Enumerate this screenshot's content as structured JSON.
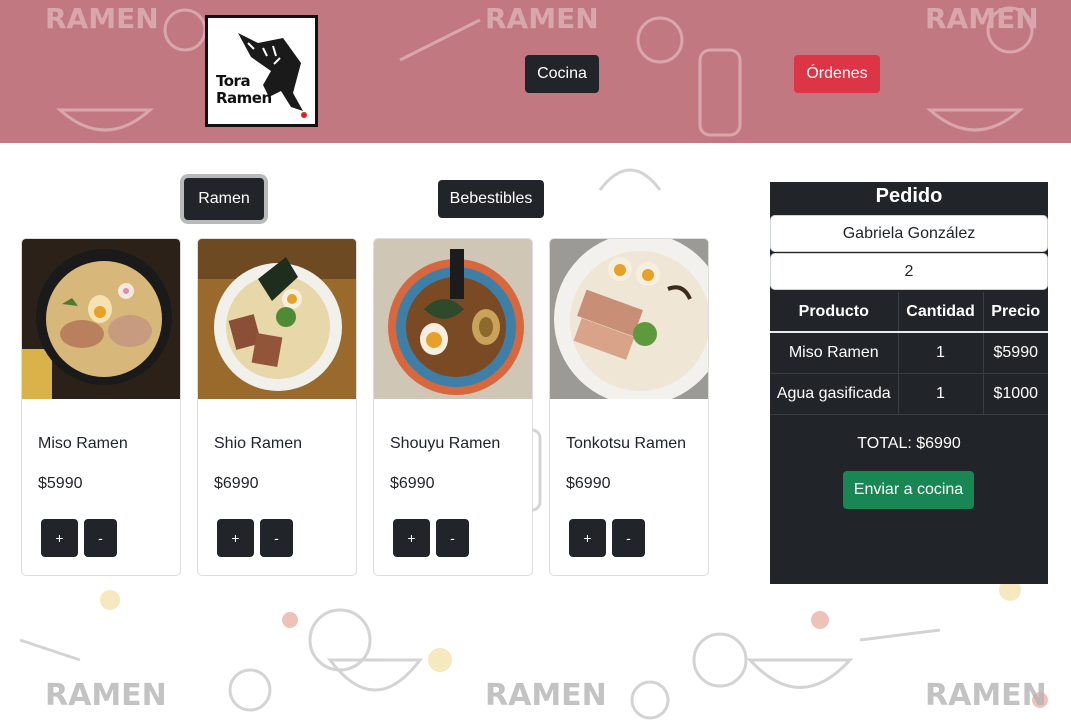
{
  "header": {
    "logo_line1": "Tora",
    "logo_line2": "Ramen",
    "nav_cocina": "Cocina",
    "nav_ordenes": "Órdenes"
  },
  "categories": {
    "ramen": "Ramen",
    "bebestibles": "Bebestibles"
  },
  "products": [
    {
      "name": "Miso Ramen",
      "price": "$5990",
      "plus": "+",
      "minus": "-"
    },
    {
      "name": "Shio Ramen",
      "price": "$6990",
      "plus": "+",
      "minus": "-"
    },
    {
      "name": "Shouyu Ramen",
      "price": "$6990",
      "plus": "+",
      "minus": "-"
    },
    {
      "name": "Tonkotsu Ramen",
      "price": "$6990",
      "plus": "+",
      "minus": "-"
    }
  ],
  "order": {
    "title": "Pedido",
    "client_name": "Gabriela González",
    "table_number": "2",
    "columns": [
      "Producto",
      "Cantidad",
      "Precio"
    ],
    "rows": [
      {
        "product": "Miso Ramen",
        "qty": "1",
        "price": "$5990"
      },
      {
        "product": "Agua gasificada",
        "qty": "1",
        "price": "$1000"
      }
    ],
    "total": "TOTAL: $6990",
    "send_button": "Enviar a cocina"
  },
  "colors": {
    "header_bg": "#b45a64",
    "dark": "#212529",
    "danger": "#dc3545",
    "success": "#198754"
  }
}
